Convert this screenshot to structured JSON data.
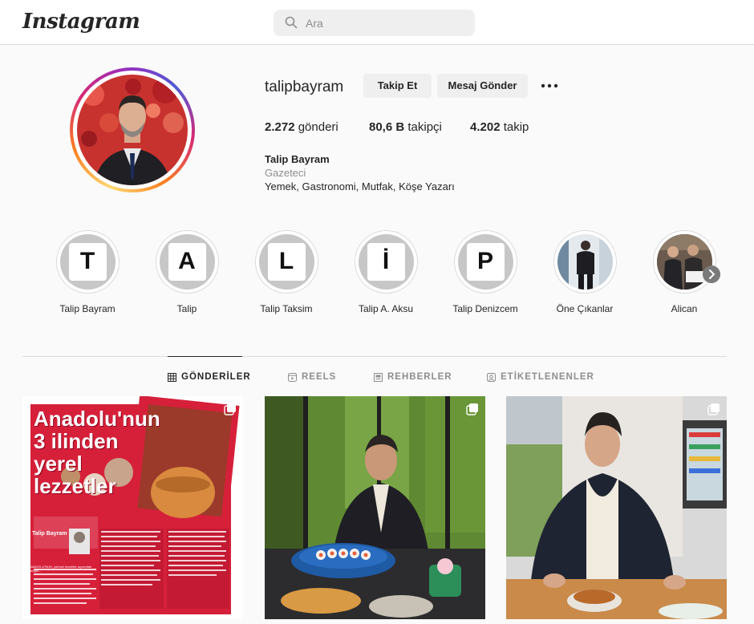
{
  "app": {
    "logo": "Instagram"
  },
  "search": {
    "placeholder": "Ara"
  },
  "profile": {
    "username": "talipbayram",
    "follow_label": "Takip Et",
    "message_label": "Mesaj Gönder",
    "stats": {
      "posts_count": "2.272",
      "posts_label": "gönderi",
      "followers_count": "80,6 B",
      "followers_label": "takipçi",
      "following_count": "4.202",
      "following_label": "takip"
    },
    "full_name": "Talip Bayram",
    "category": "Gazeteci",
    "bio": "Yemek, Gastronomi, Mutfak, Köşe Yazarı"
  },
  "highlights": [
    {
      "label": "Talip Bayram",
      "letter": "T"
    },
    {
      "label": "Talip",
      "letter": "A"
    },
    {
      "label": "Talip Taksim",
      "letter": "L"
    },
    {
      "label": "Talip A. Aksu",
      "letter": "İ"
    },
    {
      "label": "Talip Denizcem",
      "letter": "P"
    },
    {
      "label": "Öne Çıkanlar",
      "letter": ""
    },
    {
      "label": "Alican",
      "letter": ""
    }
  ],
  "tabs": [
    {
      "label": "GÖNDERİLER",
      "icon": "grid-icon",
      "active": true
    },
    {
      "label": "REELS",
      "icon": "reels-icon",
      "active": false
    },
    {
      "label": "REHBERLER",
      "icon": "guide-icon",
      "active": false
    },
    {
      "label": "ETİKETLENENLER",
      "icon": "tag-icon",
      "active": false
    }
  ],
  "posts": {
    "post1": {
      "headline": "Anadolu'nun 3 ilinden yerel lezzetler",
      "byline": "Talip Bayram",
      "body": "ANADOLU'NUN, yöresel lezzetler açısından zengin..."
    }
  },
  "colors": {
    "accent": "#0095f6",
    "text": "#262626",
    "muted": "#8e8e8e",
    "border": "#dbdbdb",
    "button_bg": "#efefef",
    "newspaper_red": "#d6203a"
  }
}
